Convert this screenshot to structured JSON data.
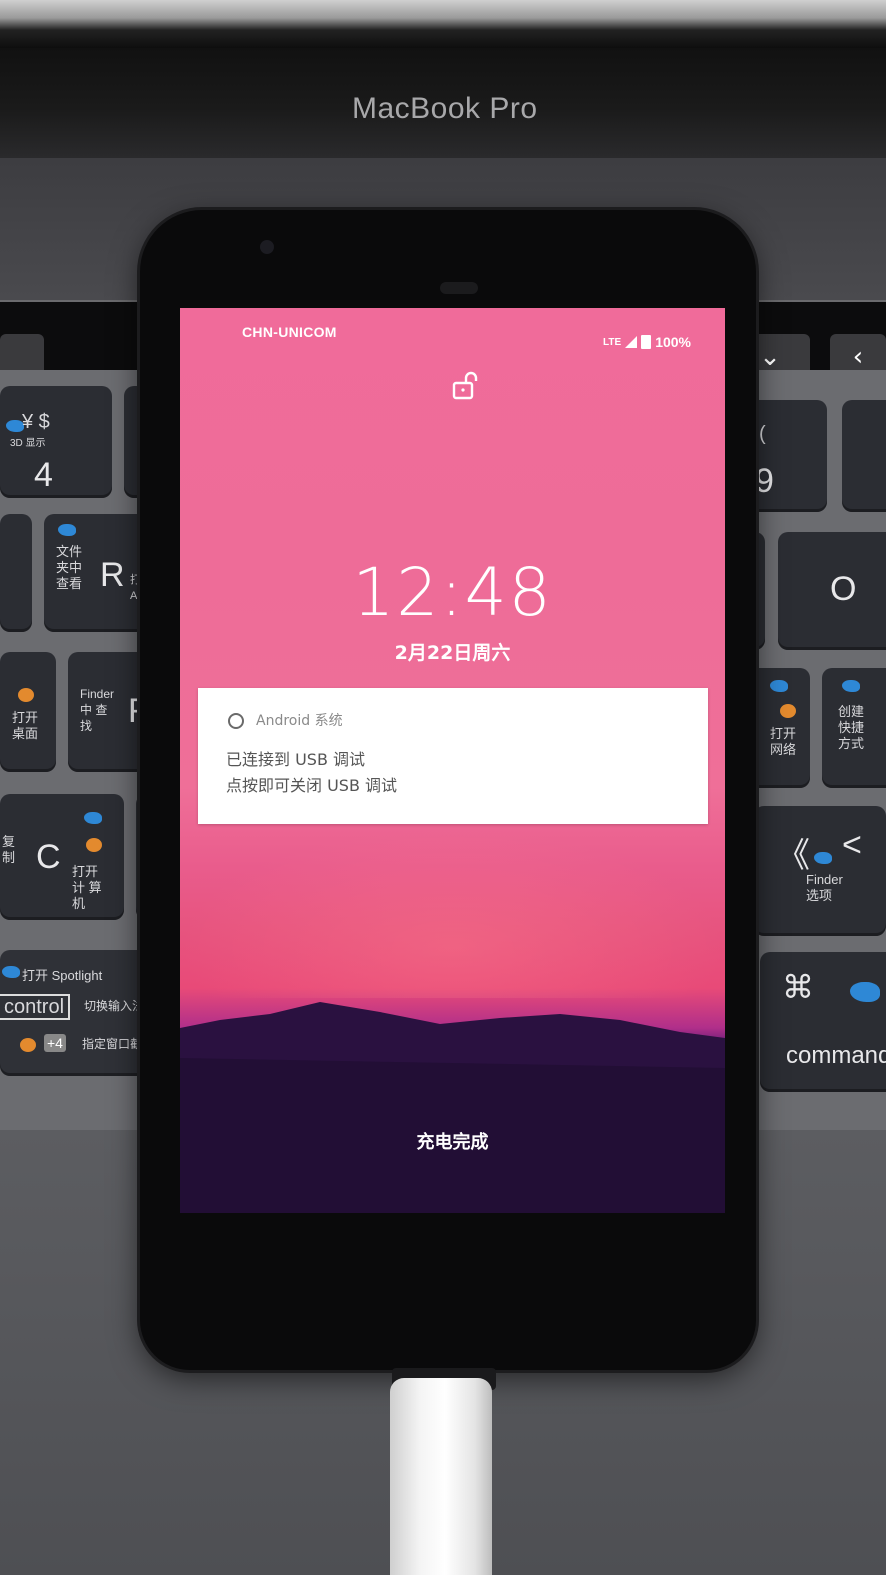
{
  "laptop": {
    "brand_label": "MacBook Pro",
    "keyboard": {
      "keys": [
        {
          "id": "4",
          "main": "4",
          "sub": "¥  $",
          "extra": "3D 显示"
        },
        {
          "id": "9",
          "main": "9",
          "sub": "("
        },
        {
          "id": "r",
          "main": "R",
          "sub": "文件 夹中 查看",
          "extra": "打开 Airdrop"
        },
        {
          "id": "o",
          "main": "O"
        },
        {
          "id": "f",
          "main": "F",
          "sub": "Finder 中 查 找",
          "extra": "打开 桌面"
        },
        {
          "id": "c",
          "main": "C",
          "sub": "复制",
          "extra": "打开 计 算机"
        },
        {
          "id": "comma",
          "main": "<",
          "sub": "《",
          "extra": "Finder 选项"
        },
        {
          "id": "command",
          "main": "command",
          "sub": "⌘"
        },
        {
          "id": "l",
          "sub": "打开 网络"
        },
        {
          "id": "semicolon",
          "sub": "创建 快捷 方式"
        }
      ],
      "shortcut_labels": [
        "打开 Spotlight",
        "control",
        "切换输入法",
        "+4",
        "指定窗口截"
      ]
    }
  },
  "phone": {
    "status_bar": {
      "carrier": "CHN-UNICOM",
      "network": "LTE",
      "battery": "100%"
    },
    "lock_icon": "unlocked-padlock-icon",
    "clock": "12:48",
    "date": "2月22日周六",
    "notification": {
      "app_icon": "android-system-icon",
      "app_name": "Android 系统",
      "title": "已连接到 USB 调试",
      "text": "点按即可关闭 USB 调试"
    },
    "charging_status": "充电完成"
  },
  "colors": {
    "wallpaper_top": "#f06b9a",
    "wallpaper_horizon": "#e84a78",
    "mountains": "#2a1140",
    "notification_bg": "#ffffff"
  }
}
